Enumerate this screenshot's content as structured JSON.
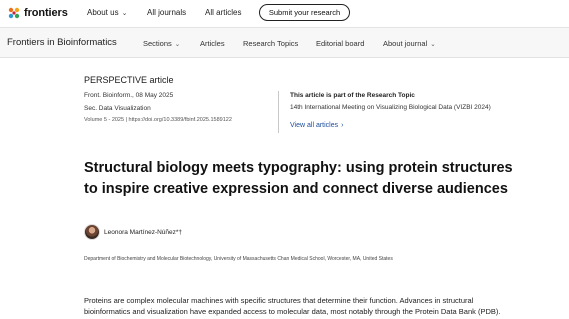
{
  "topbar": {
    "logo_text": "frontiers",
    "links": [
      {
        "label": "About us",
        "has_caret": true
      },
      {
        "label": "All journals",
        "has_caret": false
      },
      {
        "label": "All articles",
        "has_caret": false
      }
    ],
    "submit_label": "Submit your research"
  },
  "journal_nav": {
    "journal_name": "Frontiers in Bioinformatics",
    "items": [
      {
        "label": "Sections",
        "has_caret": true
      },
      {
        "label": "Articles",
        "has_caret": false
      },
      {
        "label": "Research Topics",
        "has_caret": false
      },
      {
        "label": "Editorial board",
        "has_caret": false
      },
      {
        "label": "About journal",
        "has_caret": true
      }
    ]
  },
  "article": {
    "type_label": "PERSPECTIVE article",
    "citation_line": "Front. Bioinform., 08 May 2025",
    "section_line": "Sec. Data Visualization",
    "volume_doi": "Volume 5 - 2025 | https://doi.org/10.3389/fbinf.2025.1589122",
    "research_topic_note": "This article is part of the Research Topic",
    "research_topic_title": "14th International Meeting on Visualizing Biological Data (VIZBI 2024)",
    "view_all_label": "View all articles",
    "title_line1": "Structural biology meets typography: using protein structures",
    "title_line2": "to inspire creative expression and connect diverse audiences",
    "author": "Leonora Martínez-Núñez*†",
    "affiliation": "Department of Biochemistry and Molecular Biotechnology, University of Massachusetts Chan Medical School, Worcester, MA, United States",
    "abstract_line1": "Proteins are complex molecular machines with specific structures that determine their function. Advances in structural",
    "abstract_line2": "bioinformatics and visualization have expanded access to molecular data, most notably through the Protein Data Bank (PDB)."
  },
  "colors": {
    "link_blue": "#1c4c9c",
    "journal_bar_bg": "#f7f7f7",
    "logo_orange": "#e8711a"
  },
  "icons": [
    "frontiers-logo-icon",
    "chevron-down-icon",
    "chevron-right-icon"
  ]
}
